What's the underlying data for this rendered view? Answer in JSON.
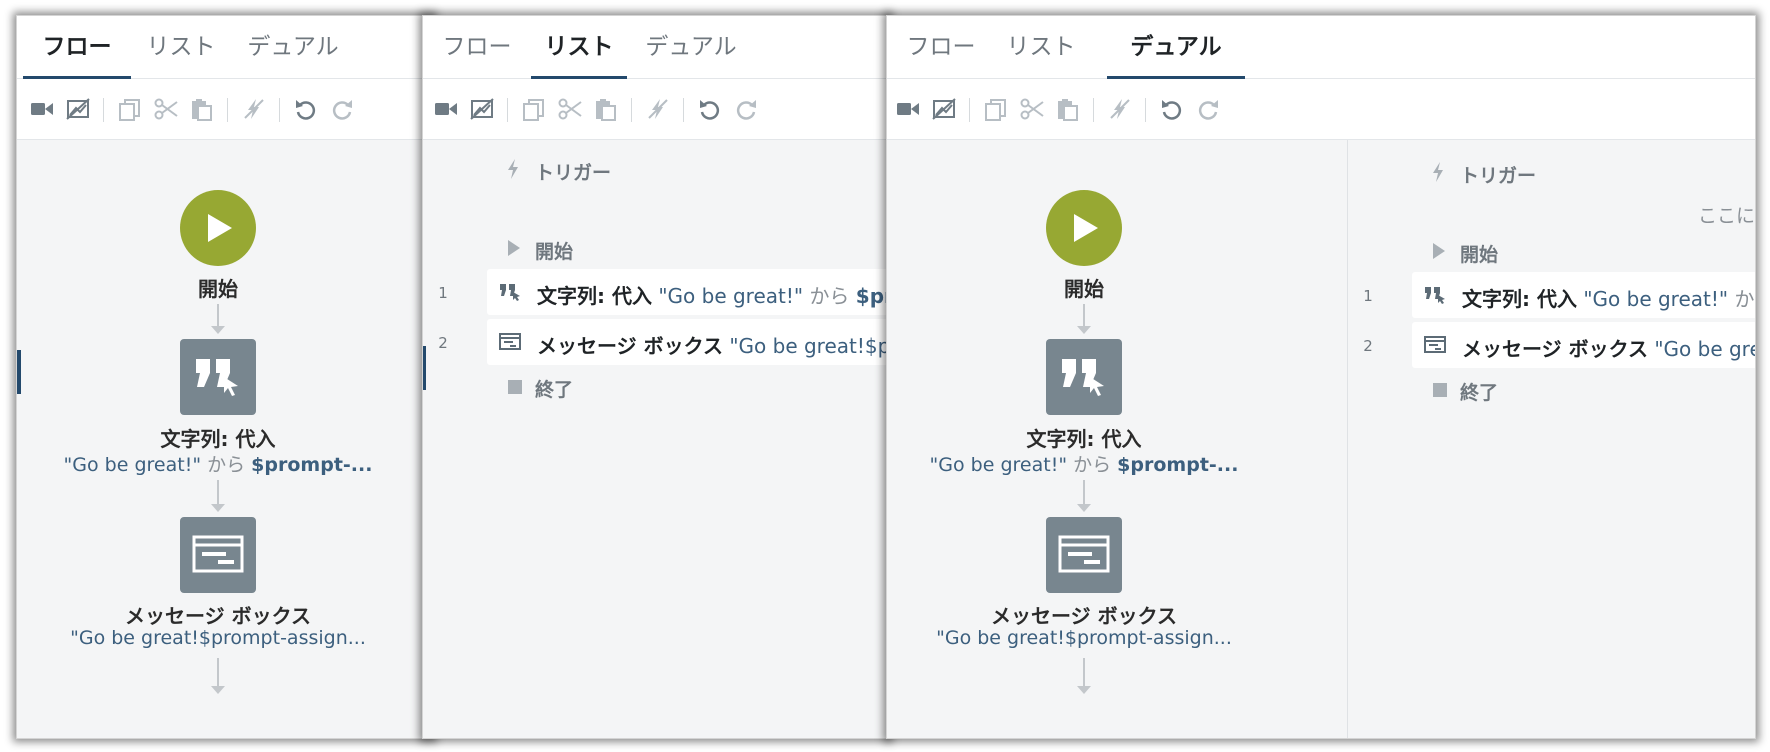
{
  "tabs": {
    "flow": "フロー",
    "list": "リスト",
    "dual": "デュアル"
  },
  "toolbar_icons": [
    "record-icon",
    "screenshot-icon",
    "copy-icon",
    "cut-icon",
    "paste-icon",
    "disable-icon",
    "undo-icon",
    "redo-icon"
  ],
  "flow": {
    "start_label": "開始",
    "node1_title": "文字列: 代入",
    "node1_str": "\"Go be great!\"",
    "node1_kara": "から",
    "node1_var": "$prompt-...",
    "node2_title": "メッセージ ボックス",
    "node2_str": "\"Go be great!$prompt-assign..."
  },
  "list": {
    "trigger": "トリガー",
    "start": "開始",
    "end": "終了",
    "row1_num": "1",
    "row1_title": "文字列: 代入",
    "row1_str": "\"Go be great!\"",
    "row1_kara": "から",
    "row1_var_p2": "$prom",
    "row1_var_p3": "$",
    "row2_num": "2",
    "row2_title": "メッセージ ボックス",
    "row2_str_p2": "\"Go be great!$pr",
    "row2_str_p3": "\"Go be great",
    "hint": "ここに"
  },
  "colors": {
    "start_green": "#97a833",
    "node_gray": "#78868f",
    "accent": "#23496c"
  }
}
